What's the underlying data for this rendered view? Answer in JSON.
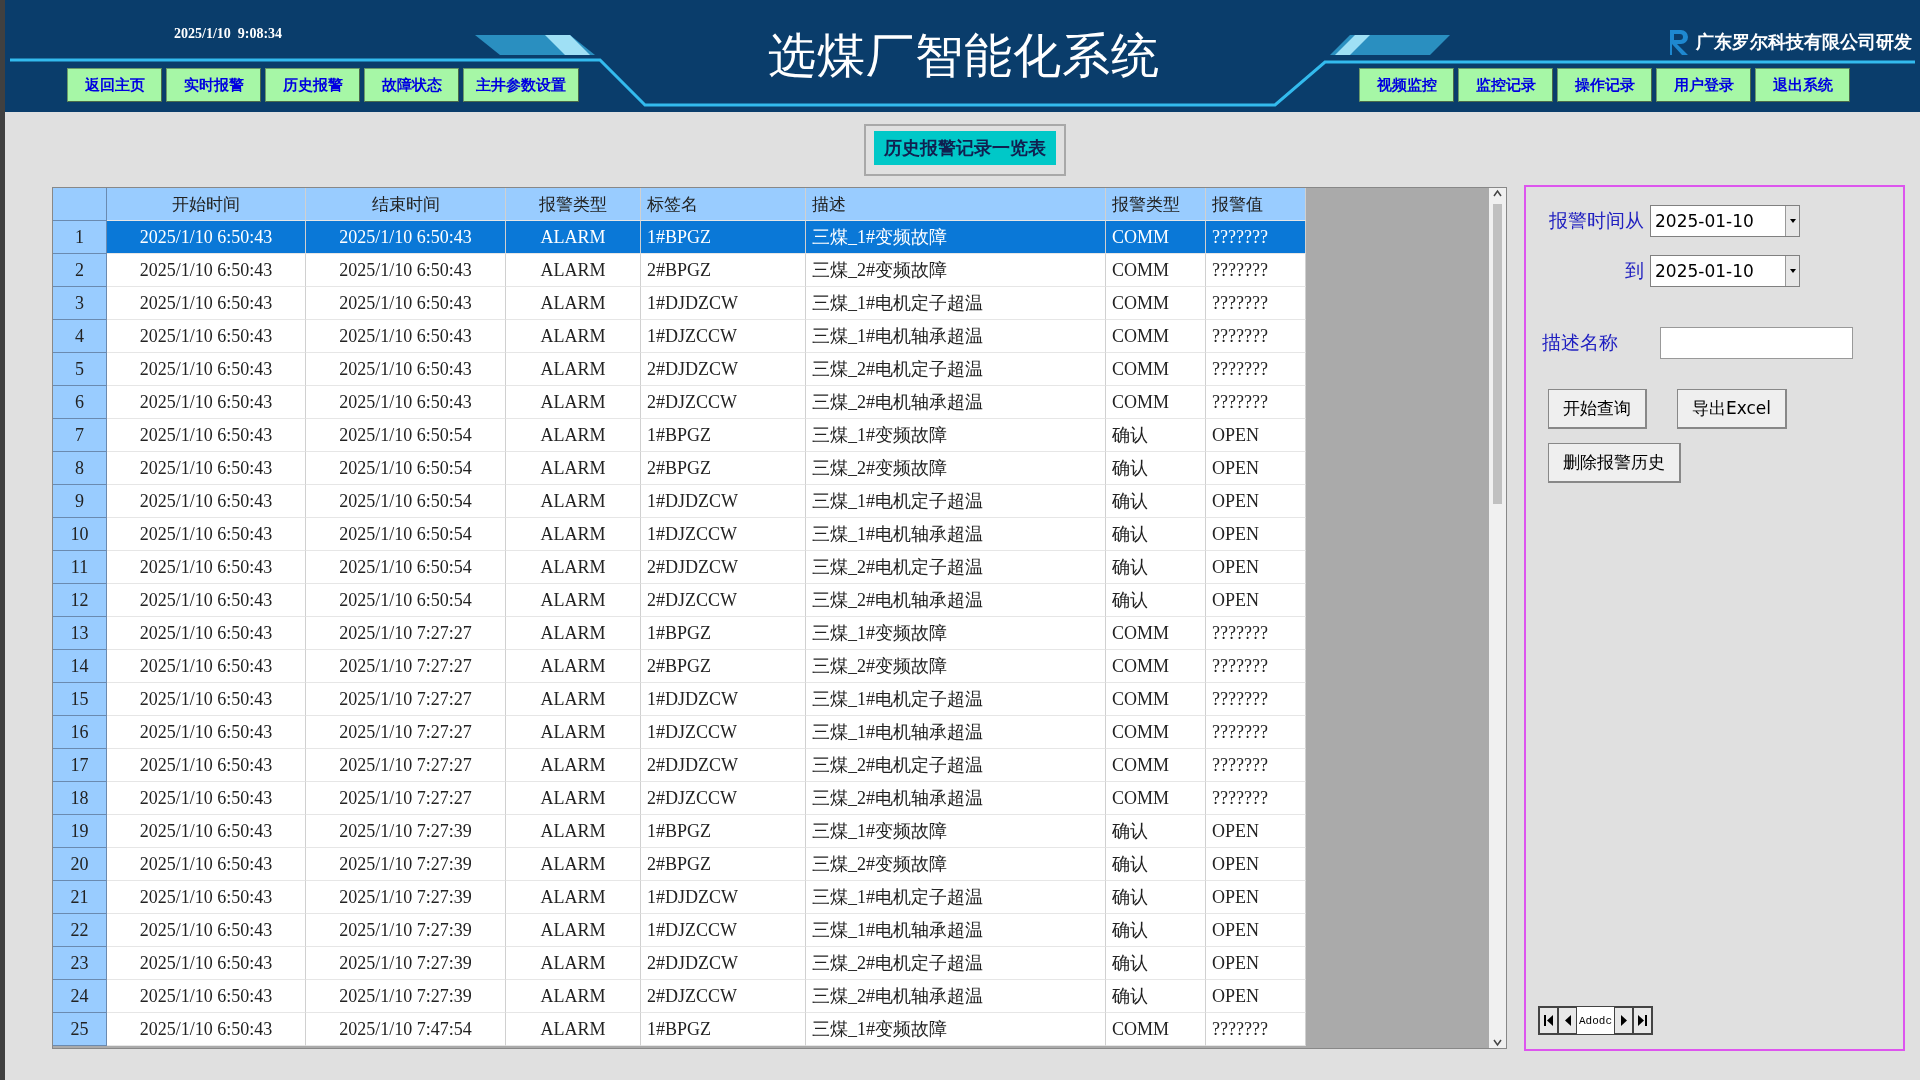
{
  "header": {
    "datetime": "2025/1/10  9:08:34",
    "title": "选煤厂智能化系统",
    "company": "广东罗尔科技有限公司研发",
    "nav_left": [
      "返回主页",
      "实时报警",
      "历史报警",
      "故障状态",
      "主井参数设置"
    ],
    "nav_right": [
      "视频监控",
      "监控记录",
      "操作记录",
      "用户登录",
      "退出系统"
    ]
  },
  "caption": "历史报警记录一览表",
  "table": {
    "columns": [
      "开始时间",
      "结束时间",
      "报警类型",
      "标签名",
      "描述",
      "报警类型",
      "报警值"
    ],
    "rows": [
      {
        "no": "1",
        "cells": [
          "2025/1/10 6:50:43",
          "2025/1/10 6:50:43",
          "ALARM",
          "1#BPGZ",
          "三煤_1#变频故障",
          "COMM",
          "???????"
        ],
        "selected": true
      },
      {
        "no": "2",
        "cells": [
          "2025/1/10 6:50:43",
          "2025/1/10 6:50:43",
          "ALARM",
          "2#BPGZ",
          "三煤_2#变频故障",
          "COMM",
          "???????"
        ],
        "selected": false
      },
      {
        "no": "3",
        "cells": [
          "2025/1/10 6:50:43",
          "2025/1/10 6:50:43",
          "ALARM",
          "1#DJDZCW",
          "三煤_1#电机定子超温",
          "COMM",
          "???????"
        ],
        "selected": false
      },
      {
        "no": "4",
        "cells": [
          "2025/1/10 6:50:43",
          "2025/1/10 6:50:43",
          "ALARM",
          "1#DJZCCW",
          "三煤_1#电机轴承超温",
          "COMM",
          "???????"
        ],
        "selected": false
      },
      {
        "no": "5",
        "cells": [
          "2025/1/10 6:50:43",
          "2025/1/10 6:50:43",
          "ALARM",
          "2#DJDZCW",
          "三煤_2#电机定子超温",
          "COMM",
          "???????"
        ],
        "selected": false
      },
      {
        "no": "6",
        "cells": [
          "2025/1/10 6:50:43",
          "2025/1/10 6:50:43",
          "ALARM",
          "2#DJZCCW",
          "三煤_2#电机轴承超温",
          "COMM",
          "???????"
        ],
        "selected": false
      },
      {
        "no": "7",
        "cells": [
          "2025/1/10 6:50:43",
          "2025/1/10 6:50:54",
          "ALARM",
          "1#BPGZ",
          "三煤_1#变频故障",
          "确认",
          "OPEN"
        ],
        "selected": false
      },
      {
        "no": "8",
        "cells": [
          "2025/1/10 6:50:43",
          "2025/1/10 6:50:54",
          "ALARM",
          "2#BPGZ",
          "三煤_2#变频故障",
          "确认",
          "OPEN"
        ],
        "selected": false
      },
      {
        "no": "9",
        "cells": [
          "2025/1/10 6:50:43",
          "2025/1/10 6:50:54",
          "ALARM",
          "1#DJDZCW",
          "三煤_1#电机定子超温",
          "确认",
          "OPEN"
        ],
        "selected": false
      },
      {
        "no": "10",
        "cells": [
          "2025/1/10 6:50:43",
          "2025/1/10 6:50:54",
          "ALARM",
          "1#DJZCCW",
          "三煤_1#电机轴承超温",
          "确认",
          "OPEN"
        ],
        "selected": false
      },
      {
        "no": "11",
        "cells": [
          "2025/1/10 6:50:43",
          "2025/1/10 6:50:54",
          "ALARM",
          "2#DJDZCW",
          "三煤_2#电机定子超温",
          "确认",
          "OPEN"
        ],
        "selected": false
      },
      {
        "no": "12",
        "cells": [
          "2025/1/10 6:50:43",
          "2025/1/10 6:50:54",
          "ALARM",
          "2#DJZCCW",
          "三煤_2#电机轴承超温",
          "确认",
          "OPEN"
        ],
        "selected": false
      },
      {
        "no": "13",
        "cells": [
          "2025/1/10 6:50:43",
          "2025/1/10 7:27:27",
          "ALARM",
          "1#BPGZ",
          "三煤_1#变频故障",
          "COMM",
          "???????"
        ],
        "selected": false
      },
      {
        "no": "14",
        "cells": [
          "2025/1/10 6:50:43",
          "2025/1/10 7:27:27",
          "ALARM",
          "2#BPGZ",
          "三煤_2#变频故障",
          "COMM",
          "???????"
        ],
        "selected": false
      },
      {
        "no": "15",
        "cells": [
          "2025/1/10 6:50:43",
          "2025/1/10 7:27:27",
          "ALARM",
          "1#DJDZCW",
          "三煤_1#电机定子超温",
          "COMM",
          "???????"
        ],
        "selected": false
      },
      {
        "no": "16",
        "cells": [
          "2025/1/10 6:50:43",
          "2025/1/10 7:27:27",
          "ALARM",
          "1#DJZCCW",
          "三煤_1#电机轴承超温",
          "COMM",
          "???????"
        ],
        "selected": false
      },
      {
        "no": "17",
        "cells": [
          "2025/1/10 6:50:43",
          "2025/1/10 7:27:27",
          "ALARM",
          "2#DJDZCW",
          "三煤_2#电机定子超温",
          "COMM",
          "???????"
        ],
        "selected": false
      },
      {
        "no": "18",
        "cells": [
          "2025/1/10 6:50:43",
          "2025/1/10 7:27:27",
          "ALARM",
          "2#DJZCCW",
          "三煤_2#电机轴承超温",
          "COMM",
          "???????"
        ],
        "selected": false
      },
      {
        "no": "19",
        "cells": [
          "2025/1/10 6:50:43",
          "2025/1/10 7:27:39",
          "ALARM",
          "1#BPGZ",
          "三煤_1#变频故障",
          "确认",
          "OPEN"
        ],
        "selected": false
      },
      {
        "no": "20",
        "cells": [
          "2025/1/10 6:50:43",
          "2025/1/10 7:27:39",
          "ALARM",
          "2#BPGZ",
          "三煤_2#变频故障",
          "确认",
          "OPEN"
        ],
        "selected": false
      },
      {
        "no": "21",
        "cells": [
          "2025/1/10 6:50:43",
          "2025/1/10 7:27:39",
          "ALARM",
          "1#DJDZCW",
          "三煤_1#电机定子超温",
          "确认",
          "OPEN"
        ],
        "selected": false
      },
      {
        "no": "22",
        "cells": [
          "2025/1/10 6:50:43",
          "2025/1/10 7:27:39",
          "ALARM",
          "1#DJZCCW",
          "三煤_1#电机轴承超温",
          "确认",
          "OPEN"
        ],
        "selected": false
      },
      {
        "no": "23",
        "cells": [
          "2025/1/10 6:50:43",
          "2025/1/10 7:27:39",
          "ALARM",
          "2#DJDZCW",
          "三煤_2#电机定子超温",
          "确认",
          "OPEN"
        ],
        "selected": false
      },
      {
        "no": "24",
        "cells": [
          "2025/1/10 6:50:43",
          "2025/1/10 7:27:39",
          "ALARM",
          "2#DJZCCW",
          "三煤_2#电机轴承超温",
          "确认",
          "OPEN"
        ],
        "selected": false
      },
      {
        "no": "25",
        "cells": [
          "2025/1/10 6:50:43",
          "2025/1/10 7:47:54",
          "ALARM",
          "1#BPGZ",
          "三煤_1#变频故障",
          "COMM",
          "???????"
        ],
        "selected": false
      }
    ]
  },
  "filter": {
    "from_label": "报警时间从",
    "from_value": "2025-01-10",
    "to_label": "到",
    "to_value": "2025-01-10",
    "desc_label": "描述名称",
    "buttons": [
      "开始查询",
      "导出Excel",
      "删除报警历史"
    ],
    "navigator_caption": "Adodc"
  }
}
